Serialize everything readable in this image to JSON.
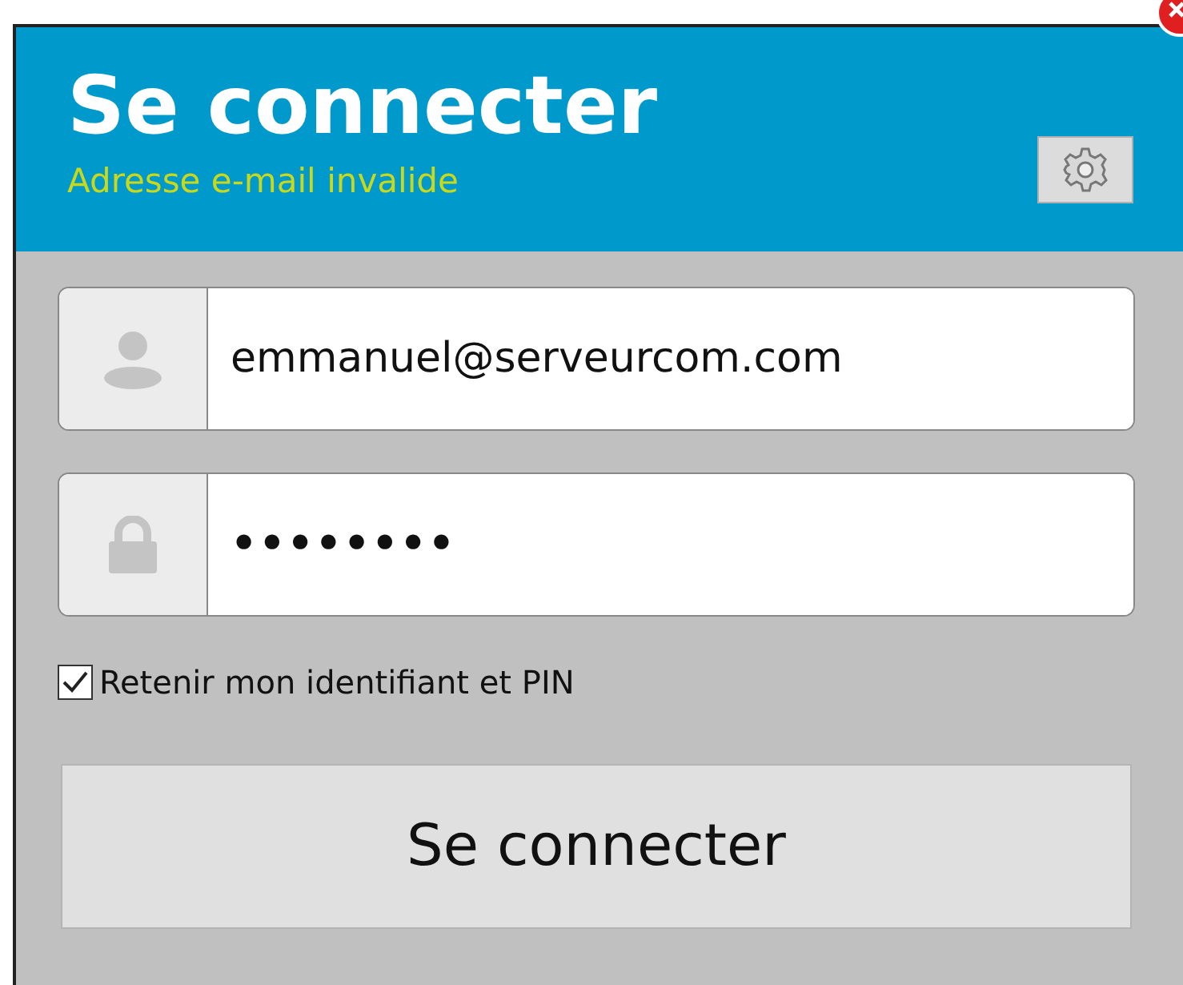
{
  "window": {
    "title": "Se connecter",
    "message": "Adresse e-mail invalide"
  },
  "fields": [
    {
      "kind": "email",
      "value": "emmanuel@serveurcom.com"
    },
    {
      "kind": "password",
      "value": "••••••••"
    }
  ],
  "remember": {
    "label": "Retenir mon identifiant et PIN",
    "checked": true
  },
  "submit": {
    "label": "Se connecter"
  }
}
